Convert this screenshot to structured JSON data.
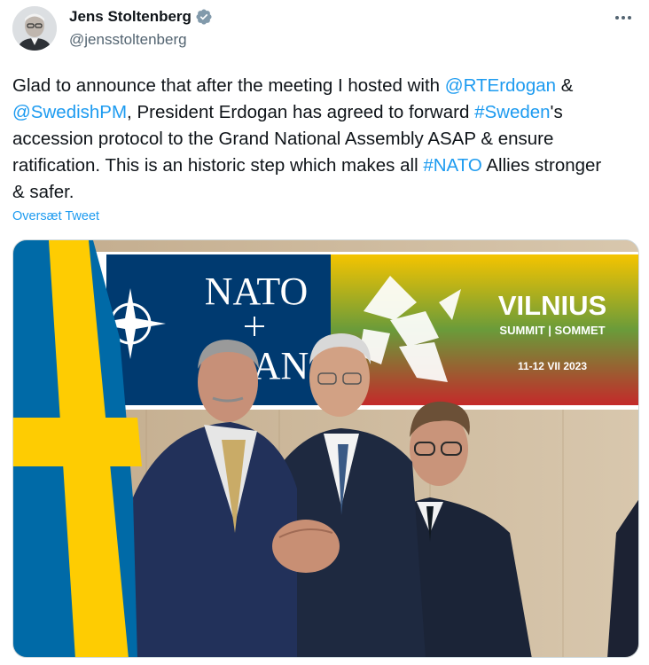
{
  "author": {
    "display_name": "Jens Stoltenberg",
    "handle": "@jensstoltenberg",
    "verified_icon": "verified-badge-icon",
    "avatar_icon": "avatar"
  },
  "menu": {
    "more_icon": "more-options-icon"
  },
  "tweet": {
    "segments": [
      {
        "type": "text",
        "value": "Glad to announce that after the meeting I hosted with "
      },
      {
        "type": "link",
        "value": "@RTErdogan"
      },
      {
        "type": "text",
        "value": " & "
      },
      {
        "type": "link",
        "value": "@SwedishPM"
      },
      {
        "type": "text",
        "value": ", President Erdogan has agreed to forward "
      },
      {
        "type": "link",
        "value": "#Sweden"
      },
      {
        "type": "text",
        "value": "'s accession protocol to the Grand National Assembly ASAP & ensure ratification. This is an historic step which makes all "
      },
      {
        "type": "link",
        "value": "#NATO"
      },
      {
        "type": "text",
        "value": " Allies stronger & safer."
      }
    ],
    "translate_label": "Oversæt Tweet"
  },
  "photo": {
    "banner_nato": "NATO",
    "banner_otan": "OTAN",
    "banner_city": "VILNIUS",
    "banner_summit": "SUMMIT | SOMMET",
    "banner_dates": "11-12 VII 2023"
  },
  "colors": {
    "link": "#1d9bf0",
    "secondary_text": "#536471",
    "verified": "#829aab",
    "nato_blue": "#003a70",
    "sweden_blue": "#006aa7",
    "sweden_yellow": "#fecc02"
  }
}
